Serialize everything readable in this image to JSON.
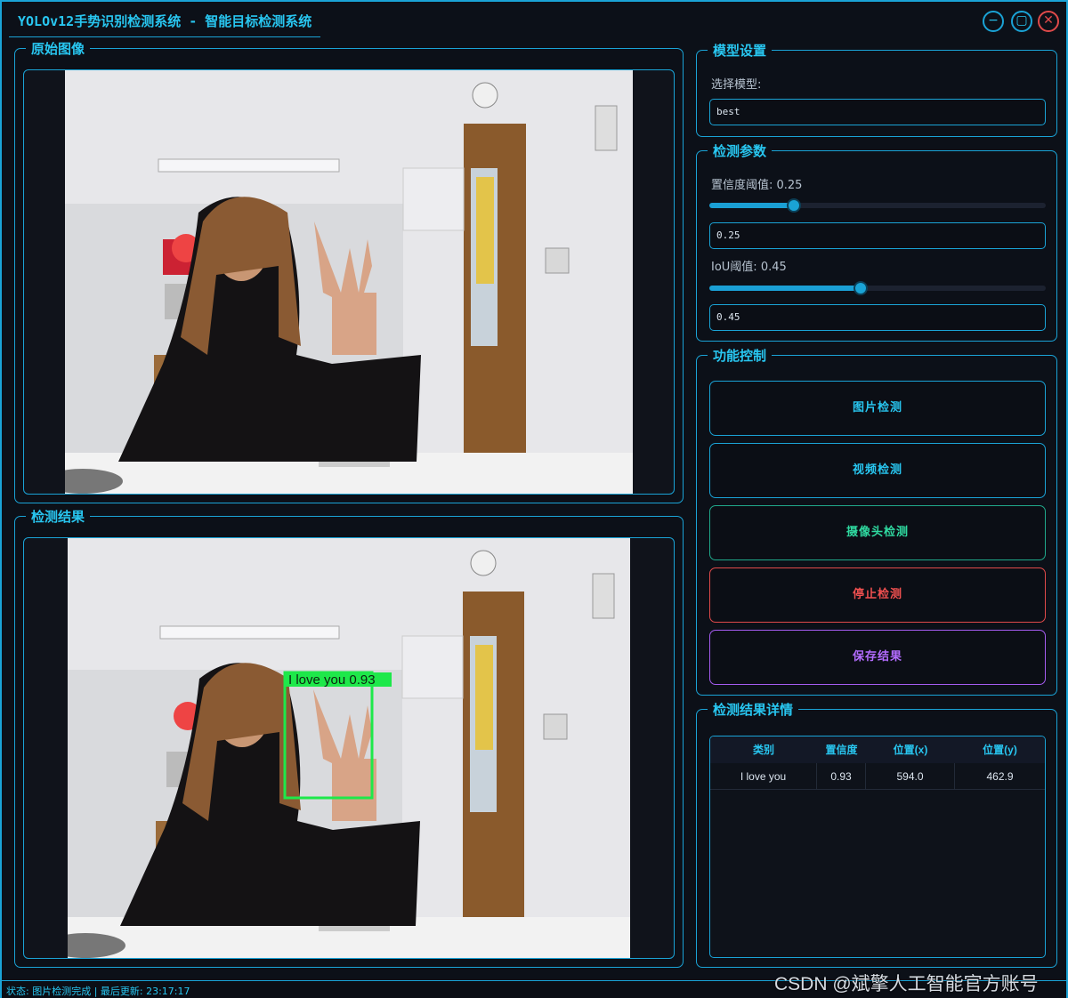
{
  "window": {
    "title": "YOLOv12手势识别检测系统 - 智能目标检测系统",
    "controls": [
      "minimize-icon",
      "maximize-icon",
      "close-icon"
    ]
  },
  "panels": {
    "original": {
      "title": "原始图像"
    },
    "result": {
      "title": "检测结果",
      "detection_label": "I love you  0.93"
    }
  },
  "model": {
    "title": "模型设置",
    "select_label": "选择模型:",
    "selected": "best"
  },
  "params": {
    "title": "检测参数",
    "conf_label": "置信度阈值: 0.25",
    "conf_value": "0.25",
    "conf_fraction": 0.25,
    "iou_label": "IoU阈值: 0.45",
    "iou_value": "0.45",
    "iou_fraction": 0.45
  },
  "controls": {
    "title": "功能控制",
    "image_detect": "图片检测",
    "video_detect": "视频检测",
    "camera_detect": "摄像头检测",
    "stop_detect": "停止检测",
    "save_result": "保存结果"
  },
  "details": {
    "title": "检测结果详情",
    "columns": [
      "类别",
      "置信度",
      "位置(x)",
      "位置(y)"
    ],
    "rows": [
      [
        "I love you",
        "0.93",
        "594.0",
        "462.9"
      ]
    ]
  },
  "status": {
    "text": "状态: 图片检测完成 | 最后更新: 23:17:17"
  },
  "watermark": "CSDN @斌擎人工智能官方账号",
  "colors": {
    "accent": "#1aa3d6",
    "image_btn": "#28c6f0",
    "camera_btn": "#2fd9a0",
    "stop_btn": "#e04a4a",
    "save_btn": "#a55cf0",
    "detection_box": "#1ee84a"
  }
}
